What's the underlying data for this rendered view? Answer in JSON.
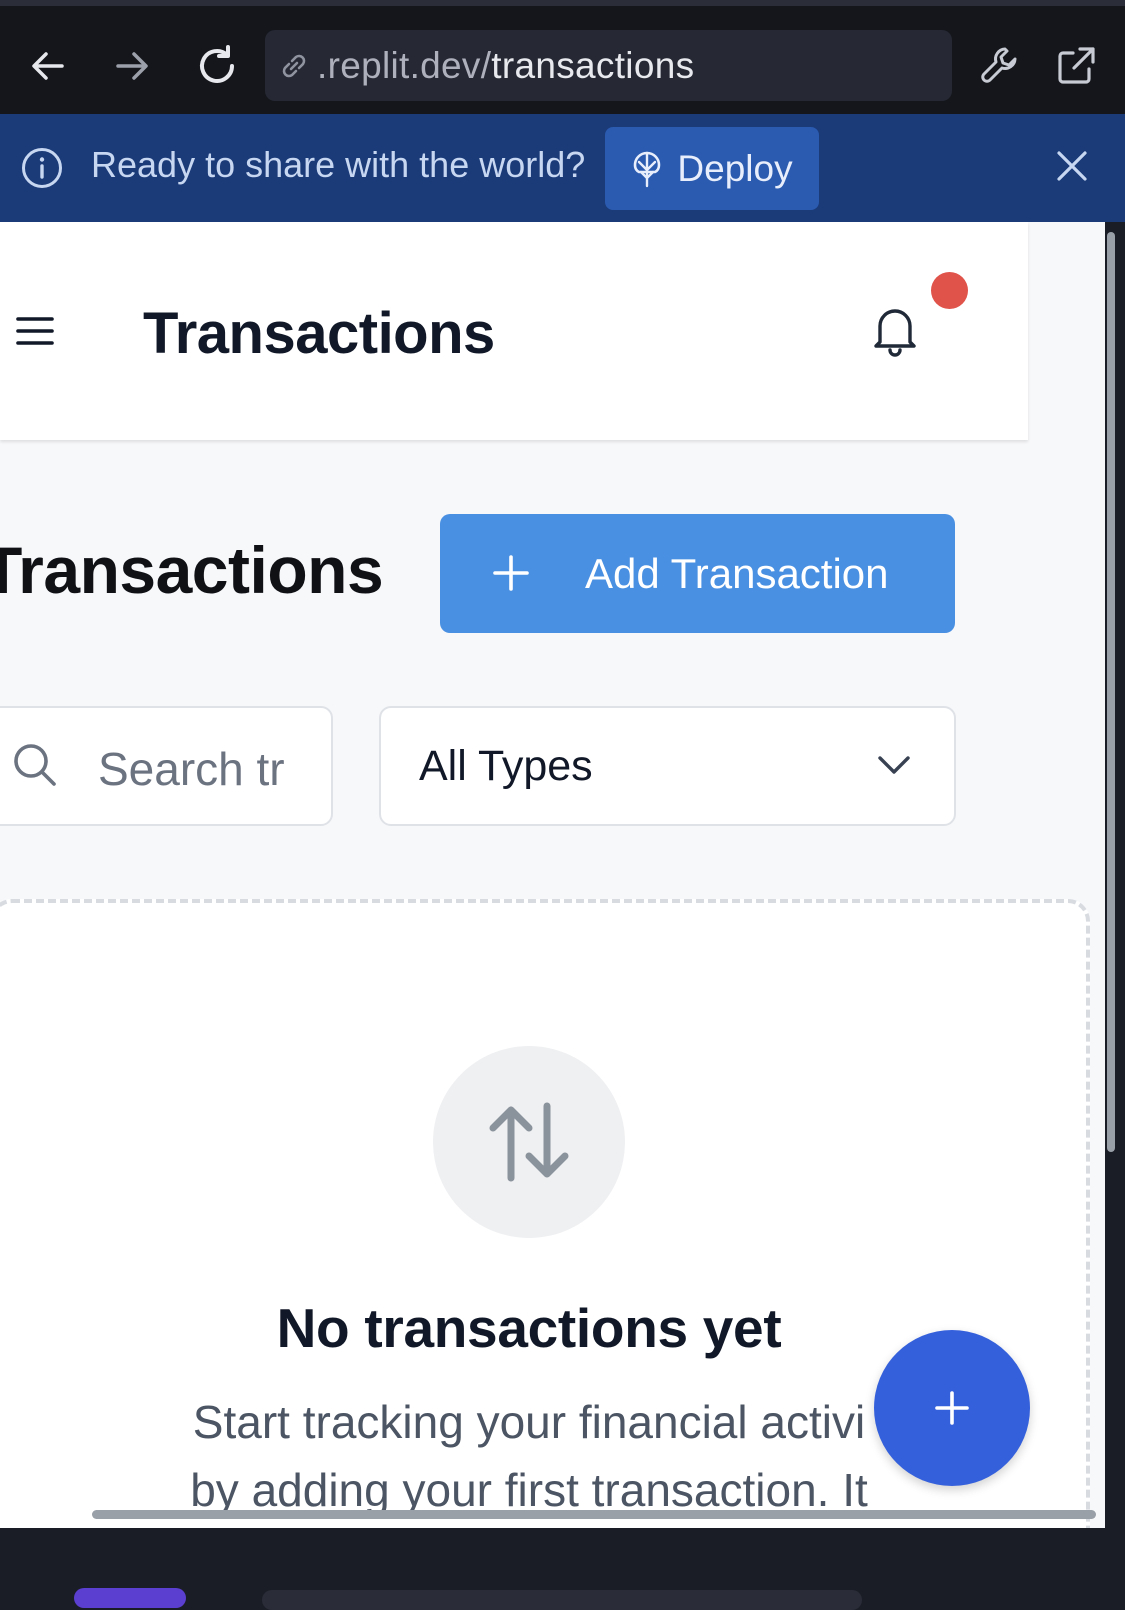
{
  "browser": {
    "url_domain": ".replit.dev/",
    "url_path": "transactions",
    "icons": [
      "back-arrow-icon",
      "forward-arrow-icon",
      "reload-icon",
      "link-icon",
      "wrench-icon",
      "external-link-icon"
    ]
  },
  "banner": {
    "message": "Ready to share with the world?",
    "deploy_label": "Deploy"
  },
  "header": {
    "title": "Transactions",
    "has_notification": true
  },
  "main": {
    "title": "Transactions",
    "add_button_label": "Add Transaction",
    "search_placeholder": "Search tr",
    "type_filter_value": "All Types",
    "empty_state": {
      "title": "No transactions yet",
      "description": "Start tracking your financial activi\nby adding your first transaction. It"
    }
  },
  "colors": {
    "accent": "#4a90e2",
    "fab": "#3560dc",
    "banner": "#1a3a78",
    "notification_dot": "#e0534a"
  }
}
